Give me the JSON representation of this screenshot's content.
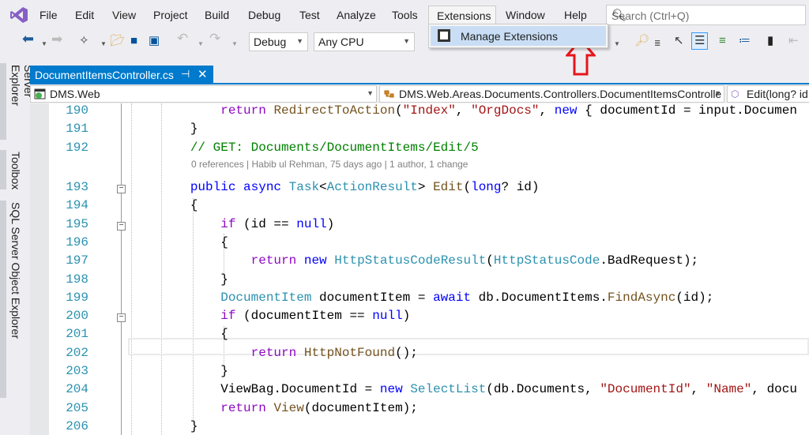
{
  "menubar": {
    "items": [
      "File",
      "Edit",
      "View",
      "Project",
      "Build",
      "Debug",
      "Test",
      "Analyze",
      "Tools",
      "Extensions",
      "Window",
      "Help"
    ],
    "search_placeholder": "Search (Ctrl+Q)"
  },
  "toolbar": {
    "configuration": "Debug",
    "platform": "Any CPU"
  },
  "extensions_menu": {
    "items": [
      {
        "label": "Manage Extensions",
        "icon": "extensions-icon"
      }
    ]
  },
  "side_tabs": [
    "Server Explorer",
    "Toolbox",
    "SQL Server Object Explorer"
  ],
  "document_tab": {
    "title": "DocumentItemsController.cs"
  },
  "navbar": {
    "project": "DMS.Web",
    "type": "DMS.Web.Areas.Documents.Controllers.DocumentItemsControlle",
    "member": "Edit(long? id"
  },
  "colors": {
    "accent": "#007acc",
    "keyword": "#0000ff",
    "control": "#8f08c4",
    "method": "#74531f",
    "string": "#a31515",
    "type": "#2b91af",
    "comment": "#008000",
    "annotation_arrow": "#e8141b"
  },
  "code": {
    "codelens": "0 references | Habib ul Rehman, 75 days ago | 1 author, 1 change",
    "lines": [
      {
        "n": "190",
        "t": [
          [
            "",
            "            "
          ],
          [
            "ctl",
            "return"
          ],
          [
            "",
            " "
          ],
          [
            "mt",
            "RedirectToAction"
          ],
          [
            "",
            "("
          ],
          [
            "str",
            "\"Index\""
          ],
          [
            "",
            ", "
          ],
          [
            "str",
            "\"OrgDocs\""
          ],
          [
            "",
            ", "
          ],
          [
            "kw",
            "new"
          ],
          [
            "",
            " { documentId = input.Documen"
          ]
        ]
      },
      {
        "n": "191",
        "t": [
          [
            "",
            "        }"
          ]
        ]
      },
      {
        "n": "192",
        "t": [
          [
            "",
            "        "
          ],
          [
            "cm",
            "// GET: Documents/DocumentItems/Edit/5"
          ]
        ]
      },
      {
        "n": "193",
        "t": [
          [
            "",
            "        "
          ],
          [
            "kw",
            "public async"
          ],
          [
            "",
            " "
          ],
          [
            "ty",
            "Task"
          ],
          [
            "",
            "<"
          ],
          [
            "ty",
            "ActionResult"
          ],
          [
            "",
            "> "
          ],
          [
            "mt",
            "Edit"
          ],
          [
            "",
            "("
          ],
          [
            "kw",
            "long"
          ],
          [
            "",
            "? id)"
          ]
        ]
      },
      {
        "n": "194",
        "t": [
          [
            "",
            "        {"
          ]
        ]
      },
      {
        "n": "195",
        "t": [
          [
            "",
            "            "
          ],
          [
            "ctl",
            "if"
          ],
          [
            "",
            " (id == "
          ],
          [
            "kw",
            "null"
          ],
          [
            "",
            ")"
          ]
        ]
      },
      {
        "n": "196",
        "t": [
          [
            "",
            "            {"
          ]
        ]
      },
      {
        "n": "197",
        "t": [
          [
            "",
            "                "
          ],
          [
            "ctl",
            "return"
          ],
          [
            "",
            " "
          ],
          [
            "kw",
            "new"
          ],
          [
            "",
            " "
          ],
          [
            "ty",
            "HttpStatusCodeResult"
          ],
          [
            "",
            "("
          ],
          [
            "ty",
            "HttpStatusCode"
          ],
          [
            "",
            ".BadRequest);"
          ]
        ]
      },
      {
        "n": "198",
        "t": [
          [
            "",
            "            }"
          ]
        ]
      },
      {
        "n": "199",
        "t": [
          [
            "",
            "            "
          ],
          [
            "ty",
            "DocumentItem"
          ],
          [
            "",
            " documentItem = "
          ],
          [
            "kw",
            "await"
          ],
          [
            "",
            " db.DocumentItems."
          ],
          [
            "mt",
            "FindAsync"
          ],
          [
            "",
            "(id);"
          ]
        ]
      },
      {
        "n": "200",
        "t": [
          [
            "",
            "            "
          ],
          [
            "ctl",
            "if"
          ],
          [
            "",
            " (documentItem == "
          ],
          [
            "kw",
            "null"
          ],
          [
            "",
            ")"
          ]
        ]
      },
      {
        "n": "201",
        "t": [
          [
            "",
            "            {"
          ]
        ]
      },
      {
        "n": "202",
        "t": [
          [
            "",
            "                "
          ],
          [
            "ctl",
            "return"
          ],
          [
            "",
            " "
          ],
          [
            "mt",
            "HttpNotFound"
          ],
          [
            "",
            "();"
          ]
        ]
      },
      {
        "n": "203",
        "t": [
          [
            "",
            "            }"
          ]
        ]
      },
      {
        "n": "204",
        "t": [
          [
            "",
            "            ViewBag.DocumentId = "
          ],
          [
            "kw",
            "new"
          ],
          [
            "",
            " "
          ],
          [
            "ty",
            "SelectList"
          ],
          [
            "",
            "(db.Documents, "
          ],
          [
            "str",
            "\"DocumentId\""
          ],
          [
            "",
            ", "
          ],
          [
            "str",
            "\"Name\""
          ],
          [
            "",
            ", docu"
          ]
        ]
      },
      {
        "n": "205",
        "t": [
          [
            "",
            "            "
          ],
          [
            "ctl",
            "return"
          ],
          [
            "",
            " "
          ],
          [
            "mt",
            "View"
          ],
          [
            "",
            "(documentItem);"
          ]
        ]
      },
      {
        "n": "206",
        "t": [
          [
            "",
            "        }"
          ]
        ]
      }
    ]
  }
}
